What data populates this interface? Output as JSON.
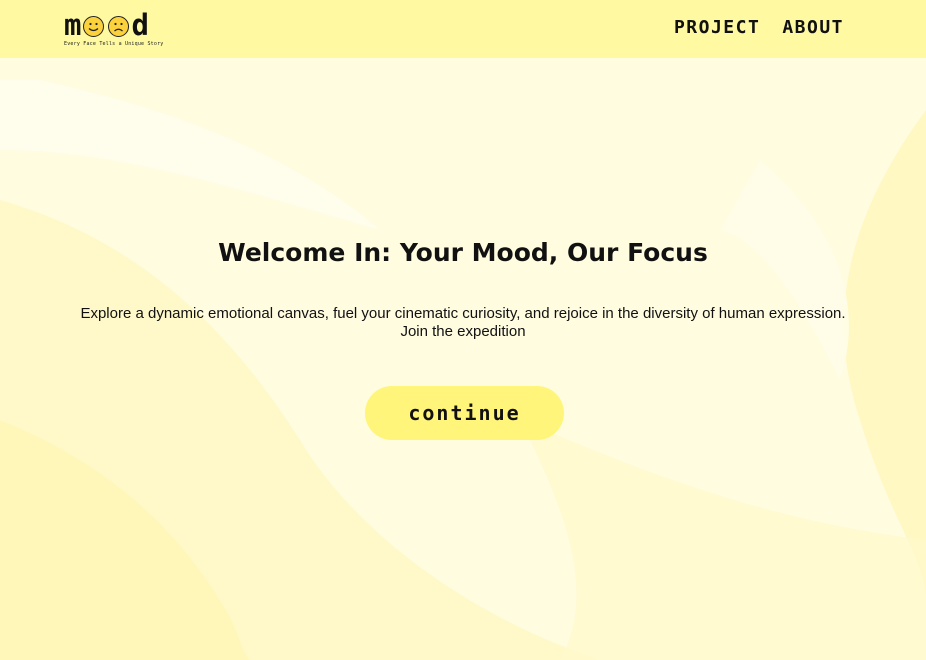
{
  "brand": {
    "logo_m": "m",
    "logo_d": "d",
    "tagline": "Every Face Tells a Unique Story",
    "face_icons": [
      "smiling-face-icon",
      "sad-face-icon"
    ]
  },
  "nav": {
    "items": [
      {
        "label": "PROJECT"
      },
      {
        "label": "ABOUT"
      }
    ]
  },
  "hero": {
    "title": "Welcome In: Your Mood, Our Focus",
    "description": "Explore a dynamic emotional canvas, fuel your cinematic curiosity, and rejoice in the diversity of human expression. Join the expedition",
    "cta_label": "continue"
  },
  "colors": {
    "header_bg": "#fff9a1",
    "page_bg": "#fffce0",
    "cta_bg": "#fff57a",
    "face": "#fcd23c",
    "text": "#111111"
  }
}
